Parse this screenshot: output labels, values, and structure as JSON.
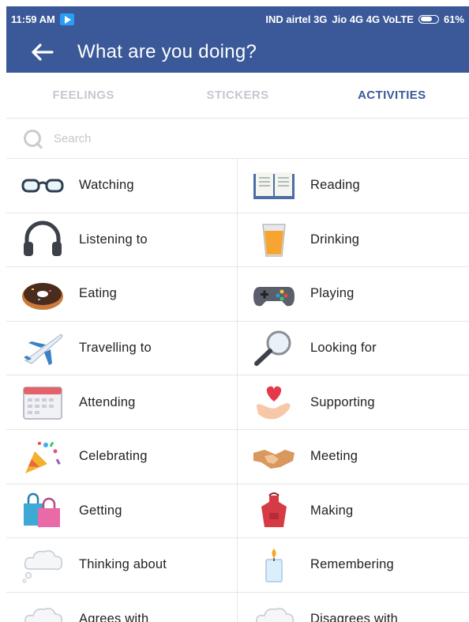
{
  "status_bar": {
    "time": "11:59 AM",
    "network": "IND airtel 3G",
    "network2": "Jio 4G 4G VoLTE",
    "battery": "61%"
  },
  "app_bar": {
    "title": "What are you doing?"
  },
  "tabs": [
    {
      "label": "FEELINGS",
      "active": false
    },
    {
      "label": "STICKERS",
      "active": false
    },
    {
      "label": "ACTIVITIES",
      "active": true
    }
  ],
  "search": {
    "placeholder": "Search"
  },
  "activities": [
    {
      "label": "Watching",
      "icon": "glasses-icon"
    },
    {
      "label": "Reading",
      "icon": "book-icon"
    },
    {
      "label": "Listening to",
      "icon": "headphones-icon"
    },
    {
      "label": "Drinking",
      "icon": "glass-icon"
    },
    {
      "label": "Eating",
      "icon": "donut-icon"
    },
    {
      "label": "Playing",
      "icon": "gamepad-icon"
    },
    {
      "label": "Travelling to",
      "icon": "airplane-icon"
    },
    {
      "label": "Looking for",
      "icon": "magnifier-icon"
    },
    {
      "label": "Attending",
      "icon": "calendar-icon"
    },
    {
      "label": "Supporting",
      "icon": "heart-hand-icon"
    },
    {
      "label": "Celebrating",
      "icon": "party-popper-icon"
    },
    {
      "label": "Meeting",
      "icon": "handshake-icon"
    },
    {
      "label": "Getting",
      "icon": "shopping-bags-icon"
    },
    {
      "label": "Making",
      "icon": "apron-icon"
    },
    {
      "label": "Thinking about",
      "icon": "thought-cloud-icon"
    },
    {
      "label": "Remembering",
      "icon": "candle-icon"
    },
    {
      "label": "Agrees with",
      "icon": "cloud-icon"
    },
    {
      "label": "Disagrees with",
      "icon": "cloud-icon"
    }
  ]
}
